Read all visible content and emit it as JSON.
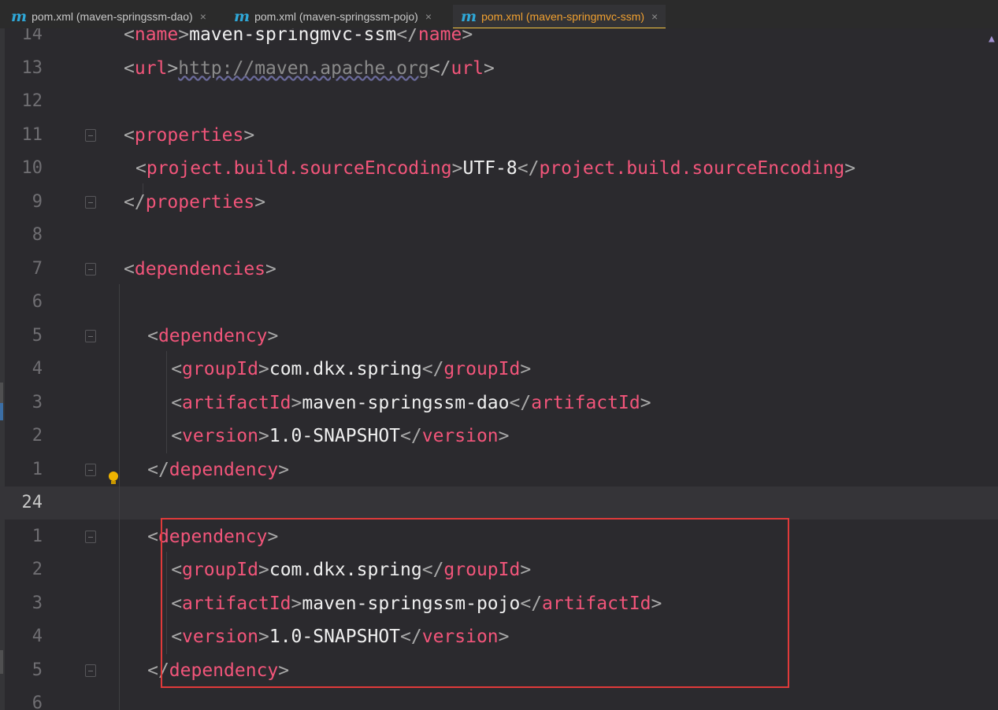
{
  "tabs": [
    {
      "icon": "maven-icon",
      "label": "pom.xml (maven-springssm-dao)",
      "close": "×",
      "active": false
    },
    {
      "icon": "maven-icon",
      "label": "pom.xml (maven-springssm-pojo)",
      "close": "×",
      "active": false
    },
    {
      "icon": "maven-icon",
      "label": "pom.xml (maven-springmvc-ssm)",
      "close": "×",
      "active": true
    }
  ],
  "colors": {
    "tag": "#f2557a",
    "text": "#f0f0f0",
    "bracket": "#a9a9a9",
    "active_tab": "#f0a030",
    "highlight_box": "#e03a3a"
  },
  "gutter_icons": {
    "intention": "lightbulb-icon",
    "warning": "warning-icon"
  },
  "warning_glyph": "▲",
  "tab_icon_glyph": "m",
  "lines": [
    {
      "num": "14",
      "open": "<",
      "tag": "name",
      "mid": ">",
      "text": "maven-springmvc-ssm",
      "close_open": "</",
      "close_tag": "name",
      "end": ">"
    },
    {
      "num": "13",
      "open": "<",
      "tag": "url",
      "mid": ">",
      "text": "http://maven.apache.org",
      "close_open": "</",
      "close_tag": "url",
      "end": ">"
    },
    {
      "num": "12"
    },
    {
      "num": "11",
      "open": "<",
      "tag": "properties",
      "end": ">"
    },
    {
      "num": "10",
      "open": "<",
      "tag": "project.build.sourceEncoding",
      "mid": ">",
      "text": "UTF-8",
      "close_open": "</",
      "close_tag": "project.build.sourceEncoding",
      "end": ">"
    },
    {
      "num": "9",
      "open": "</",
      "tag": "properties",
      "end": ">"
    },
    {
      "num": "8"
    },
    {
      "num": "7",
      "open": "<",
      "tag": "dependencies",
      "end": ">"
    },
    {
      "num": "6"
    },
    {
      "num": "5",
      "open": "<",
      "tag": "dependency",
      "end": ">"
    },
    {
      "num": "4",
      "open": "<",
      "tag": "groupId",
      "mid": ">",
      "text": "com.dkx.spring",
      "close_open": "</",
      "close_tag": "groupId",
      "end": ">"
    },
    {
      "num": "3",
      "open": "<",
      "tag": "artifactId",
      "mid": ">",
      "text": "maven-springssm-dao",
      "close_open": "</",
      "close_tag": "artifactId",
      "end": ">"
    },
    {
      "num": "2",
      "open": "<",
      "tag": "version",
      "mid": ">",
      "text": "1.0-SNAPSHOT",
      "close_open": "</",
      "close_tag": "version",
      "end": ">"
    },
    {
      "num": "1",
      "open": "</",
      "tag": "dependency",
      "end": ">"
    },
    {
      "num": "24"
    },
    {
      "num": "1",
      "open": "<",
      "tag": "dependency",
      "end": ">"
    },
    {
      "num": "2",
      "open": "<",
      "tag": "groupId",
      "mid": ">",
      "text": "com.dkx.spring",
      "close_open": "</",
      "close_tag": "groupId",
      "end": ">"
    },
    {
      "num": "3",
      "open": "<",
      "tag": "artifactId",
      "mid": ">",
      "text": "maven-springssm-pojo",
      "close_open": "</",
      "close_tag": "artifactId",
      "end": ">"
    },
    {
      "num": "4",
      "open": "<",
      "tag": "version",
      "mid": ">",
      "text": "1.0-SNAPSHOT",
      "close_open": "</",
      "close_tag": "version",
      "end": ">"
    },
    {
      "num": "5",
      "open": "</",
      "tag": "dependency",
      "end": ">"
    },
    {
      "num": "6"
    }
  ]
}
